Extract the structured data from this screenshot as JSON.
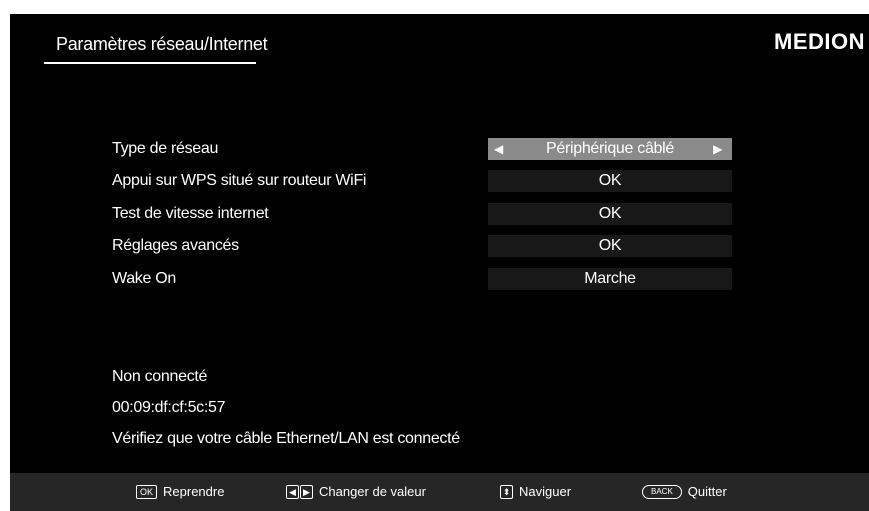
{
  "header": {
    "title": "Paramètres réseau/Internet",
    "brand": "MEDION"
  },
  "settings": [
    {
      "label": "Type de réseau",
      "value": "Périphérique câblé",
      "selected": true
    },
    {
      "label": "Appui sur WPS situé sur routeur WiFi",
      "value": "OK",
      "selected": false
    },
    {
      "label": "Test de vitesse internet",
      "value": "OK",
      "selected": false
    },
    {
      "label": "Réglages avancés",
      "value": "OK",
      "selected": false
    },
    {
      "label": "Wake On",
      "value": "Marche",
      "selected": false
    }
  ],
  "status": {
    "connection": "Non connecté",
    "mac_address": "00:09:df:cf:5c:57",
    "hint": "Vérifiez que votre câble Ethernet/LAN est connecté"
  },
  "footer": {
    "ok_key": "OK",
    "ok_label": "Reprendre",
    "left_key": "◀",
    "right_key": "▶",
    "change_label": "Changer de valeur",
    "nav_key": "⬍",
    "nav_label": "Naviguer",
    "back_key": "BACK",
    "back_label": "Quitter"
  },
  "icons": {
    "left_arrow": "◀",
    "right_arrow": "▶"
  }
}
